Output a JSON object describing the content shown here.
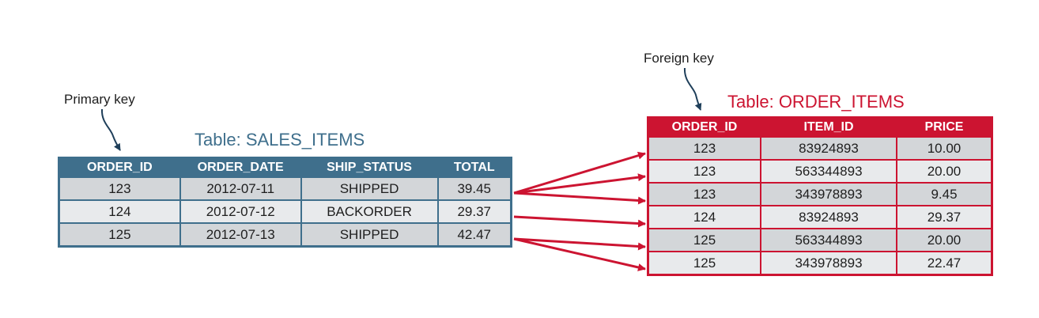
{
  "labels": {
    "primary_key": "Primary key",
    "foreign_key": "Foreign key"
  },
  "sales_items": {
    "title": "Table: SALES_ITEMS",
    "columns": [
      "ORDER_ID",
      "ORDER_DATE",
      "SHIP_STATUS",
      "TOTAL"
    ],
    "rows": [
      [
        "123",
        "2012-07-11",
        "SHIPPED",
        "39.45"
      ],
      [
        "124",
        "2012-07-12",
        "BACKORDER",
        "29.37"
      ],
      [
        "125",
        "2012-07-13",
        "SHIPPED",
        "42.47"
      ]
    ]
  },
  "order_items": {
    "title": "Table: ORDER_ITEMS",
    "columns": [
      "ORDER_ID",
      "ITEM_ID",
      "PRICE"
    ],
    "rows": [
      [
        "123",
        "83924893",
        "10.00"
      ],
      [
        "123",
        "563344893",
        "20.00"
      ],
      [
        "123",
        "343978893",
        "9.45"
      ],
      [
        "124",
        "83924893",
        "29.37"
      ],
      [
        "125",
        "563344893",
        "20.00"
      ],
      [
        "125",
        "343978893",
        "22.47"
      ]
    ]
  },
  "colors": {
    "sales_header": "#3f6f8c",
    "order_header": "#cc1431",
    "arrow": "#cc1431",
    "key_arrow": "#1f3f5a"
  }
}
